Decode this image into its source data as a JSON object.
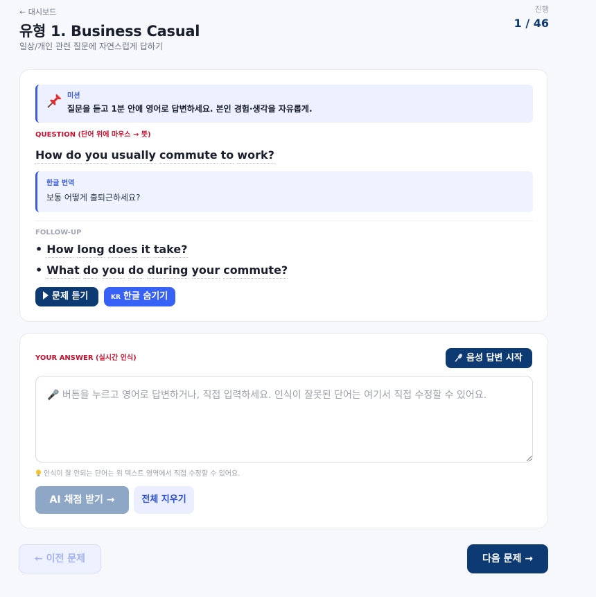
{
  "header": {
    "back_link": "← 대시보드",
    "title": "유형 1. Business Casual",
    "subtitle": "일상/개인 관련 질문에 자연스럽게 답하기",
    "progress_label": "진행",
    "progress_value": "1 / 46"
  },
  "mission": {
    "icon": "pushpin-icon",
    "label": "미션",
    "text": "질문을 듣고 1분 안에 영어로 답변하세요. 본인 경험·생각을 자유롭게."
  },
  "question": {
    "label": "QUESTION (단어 위에 마우스 → 뜻)",
    "words": [
      "How",
      "do",
      "you",
      "usually",
      "commute",
      "to",
      "work?"
    ]
  },
  "translation": {
    "label": "한글 번역",
    "text": "보통 어떻게 출퇴근하세요?"
  },
  "followup": {
    "label": "FOLLOW-UP",
    "bullet": "•",
    "items": [
      [
        "How",
        "long",
        "does",
        "it",
        "take?"
      ],
      [
        "What",
        "do",
        "you",
        "do",
        "during",
        "your",
        "commute?"
      ]
    ]
  },
  "question_buttons": {
    "play_label": "문제 듣기",
    "korean_badge": "KR",
    "korean_label": "한글 숨기기"
  },
  "answer": {
    "label": "YOUR ANSWER (실시간 인식)",
    "voice_button": "음성 답변 시작",
    "placeholder": "🎤 버튼을 누르고 영어로 답변하거나, 직접 입력하세요. 인식이 잘못된 단어는 여기서 직접 수정할 수 있어요.",
    "value": "",
    "hint": "인식이 잘 안되는 단어는 위 텍스트 영역에서 직접 수정할 수 있어요.",
    "grade_button": "AI 채점 받기 →",
    "clear_button": "전체 지우기"
  },
  "nav": {
    "prev": "← 이전 문제",
    "next": "다음 문제 →"
  },
  "colors": {
    "primary_navy": "#0e3a74",
    "accent_blue": "#3861f5",
    "label_red": "#c8102e",
    "mission_bg": "#edf0ff"
  }
}
